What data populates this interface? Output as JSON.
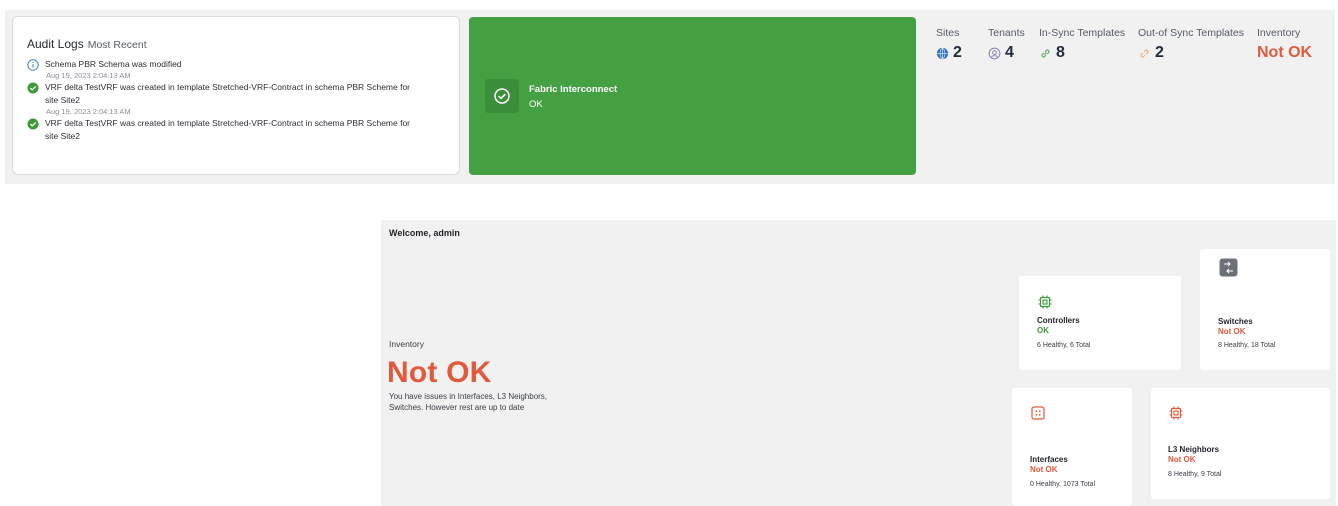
{
  "audit_logs": {
    "title": "Audit Logs",
    "subtitle": "Most Recent",
    "entries": [
      {
        "type": "info",
        "text": "Schema PBR Schema was modified"
      },
      {
        "time": "Aug 19, 2023 2:04:13 AM",
        "type": "success",
        "text": "VRF delta TestVRF was created in template Stretched-VRF-Contract in schema PBR Scheme for site Site2"
      },
      {
        "time": "Aug 19, 2023 2:04:13 AM",
        "type": "success",
        "text": "VRF delta TestVRF was created in template Stretched-VRF-Contract in schema PBR Scheme for site Site2"
      }
    ]
  },
  "fabric": {
    "title": "Fabric Interconnect",
    "status": "OK",
    "color": "#45a043"
  },
  "stats": {
    "sites": {
      "label": "Sites",
      "value": "2",
      "icon": "globe-icon"
    },
    "tenants": {
      "label": "Tenants",
      "value": "4",
      "icon": "tenant-icon"
    },
    "in_sync": {
      "label": "In-Sync Templates",
      "value": "8",
      "icon": "link-icon"
    },
    "out_of_sync": {
      "label": "Out-of Sync Templates",
      "value": "2",
      "icon": "broken-link-icon"
    },
    "inventory": {
      "label": "Inventory",
      "value": "Not OK"
    }
  },
  "overview": {
    "welcome": "Welcome, admin",
    "inventory_label": "Inventory",
    "inventory_status": "Not OK",
    "inventory_desc": "You have issues in Interfaces, L3 Neighbors, Switches. However rest are up to date"
  },
  "tiles": {
    "controllers": {
      "name": "Controllers",
      "status": "OK",
      "counts": "6 Healthy, 6 Total",
      "icon": "chip-icon"
    },
    "switches": {
      "name": "Switches",
      "status": "Not OK",
      "counts": "8 Healthy, 18 Total",
      "icon": "switch-icon"
    },
    "interfaces": {
      "name": "Interfaces",
      "status": "Not OK",
      "counts": "0 Healthy, 1073 Total",
      "icon": "interface-icon"
    },
    "l3_neighbors": {
      "name": "L3 Neighbors",
      "status": "Not OK",
      "counts": "8 Healthy, 9 Total",
      "icon": "chip-icon"
    }
  },
  "colors": {
    "ok": "#3c9a3a",
    "not_ok": "#e05a3b",
    "panel_bg": "#f1f1f2"
  }
}
